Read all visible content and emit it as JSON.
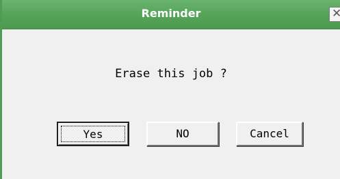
{
  "window": {
    "title": "Reminder",
    "close_glyph": "✕",
    "accent_color": "#55a45a"
  },
  "message": "Erase this job ?",
  "buttons": {
    "yes_label": "Yes",
    "no_label": "NO",
    "cancel_label": "Cancel"
  },
  "icons": {
    "close": "close-icon"
  }
}
